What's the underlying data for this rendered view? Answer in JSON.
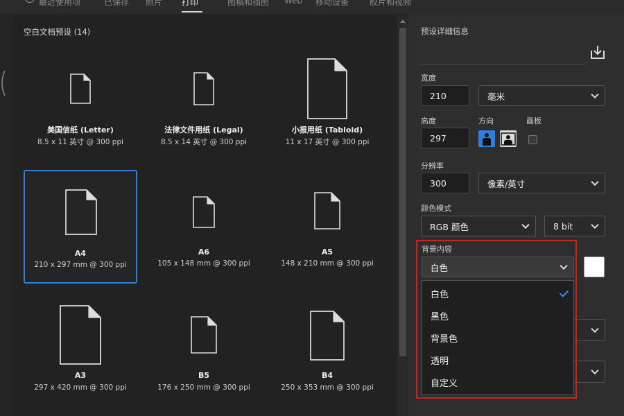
{
  "top_tabs": [
    "最近使用项",
    "已保存",
    "照片",
    "打印",
    "图稿和插图",
    "Web",
    "移动设备",
    "胶片和视频"
  ],
  "section_title": "空白文档预设 (14)",
  "presets": [
    {
      "name": "美国信纸 (Letter)",
      "size": "8.5 x 11 英寸 @ 300 ppi",
      "selected": false
    },
    {
      "name": "法律文件用纸 (Legal)",
      "size": "8.5 x 14 英寸 @ 300 ppi",
      "selected": false
    },
    {
      "name": "小报用纸 (Tabloid)",
      "size": "11 x 17 英寸 @ 300 ppi",
      "selected": false
    },
    {
      "name": "A4",
      "size": "210 x 297 mm @ 300 ppi",
      "selected": true
    },
    {
      "name": "A6",
      "size": "105 x 148 mm @ 300 ppi",
      "selected": false
    },
    {
      "name": "A5",
      "size": "148 x 210 mm @ 300 ppi",
      "selected": false
    },
    {
      "name": "A3",
      "size": "297 x 420 mm @ 300 ppi",
      "selected": false
    },
    {
      "name": "B5",
      "size": "176 x 250 mm @ 300 ppi",
      "selected": false
    },
    {
      "name": "B4",
      "size": "250 x 353 mm @ 300 ppi",
      "selected": false
    }
  ],
  "details": {
    "title": "预设详细信息",
    "width_label": "宽度",
    "width_value": "210",
    "width_unit": "毫米",
    "height_label": "高度",
    "height_value": "297",
    "orientation_label": "方向",
    "artboard_label": "画板",
    "resolution_label": "分辨率",
    "resolution_value": "300",
    "resolution_unit": "像素/英寸",
    "color_mode_label": "颜色模式",
    "color_mode_value": "RGB 颜色",
    "bit_depth_value": "8 bit",
    "background_label": "背景内容",
    "background_value": "白色",
    "background_options": [
      "白色",
      "黑色",
      "背景色",
      "透明",
      "自定义"
    ],
    "background_selected_index": 0
  },
  "colors": {
    "accent": "#2d7fe0",
    "highlight": "#c8241c",
    "swatch": "#ffffff"
  },
  "icons": [
    "save-preset-icon",
    "portrait-icon",
    "landscape-icon",
    "document-icon",
    "checkmark-icon",
    "chevron-down-icon"
  ]
}
